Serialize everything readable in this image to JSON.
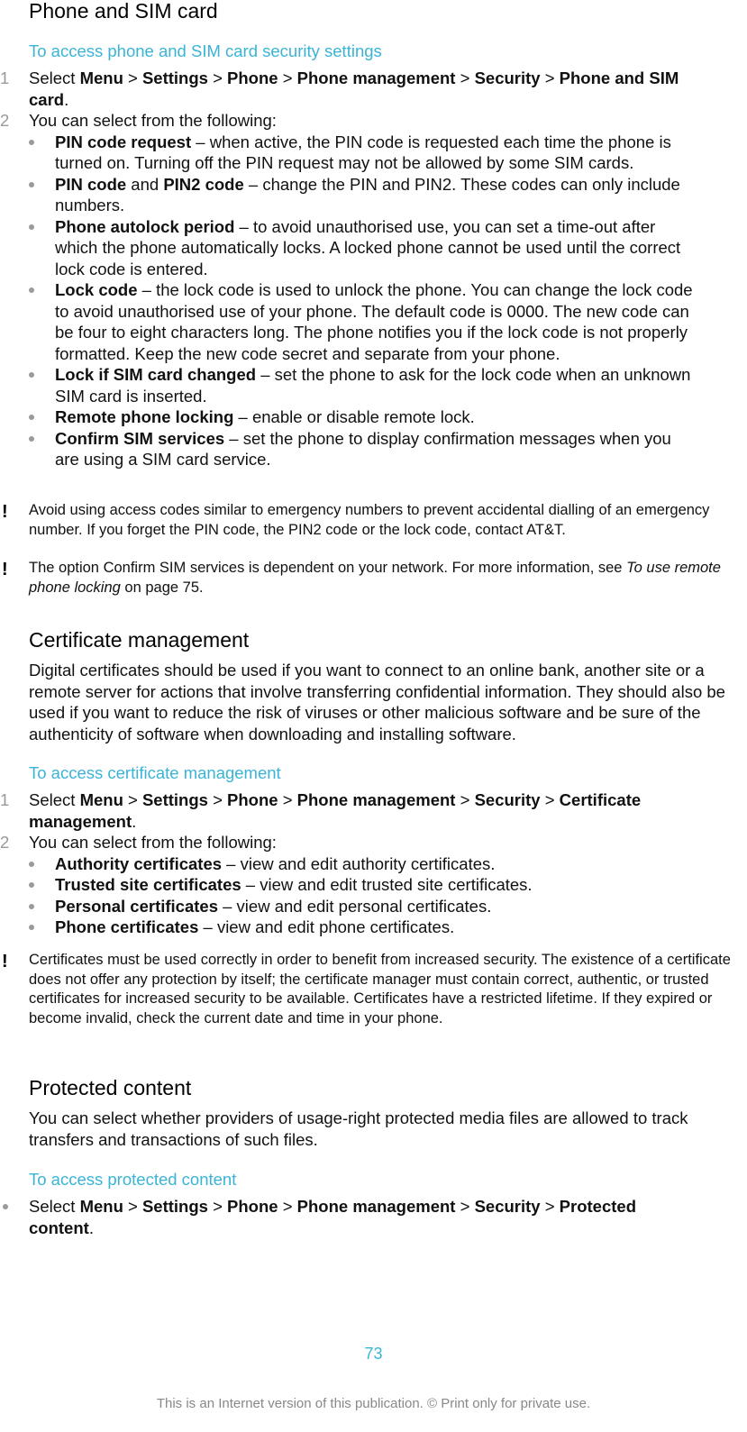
{
  "section1": {
    "title": "Phone and SIM card",
    "task_title": "To access phone and SIM card security settings",
    "step1": {
      "num": "1",
      "prefix": "Select ",
      "path": [
        "Menu",
        "Settings",
        "Phone",
        "Phone management",
        "Security",
        "Phone and SIM card"
      ],
      "sep": " > ",
      "suffix": "."
    },
    "step2": {
      "num": "2",
      "text": "You can select from the following:"
    },
    "options": [
      {
        "term": "PIN code request",
        "desc": " – when active, the PIN code is requested each time the phone is turned on. Turning off the PIN request may not be allowed by some SIM cards."
      },
      {
        "term": "PIN code",
        "mid": " and ",
        "term2": "PIN2 code",
        "desc": " – change the PIN and PIN2. These codes can only include numbers."
      },
      {
        "term": "Phone autolock period",
        "desc": " – to avoid unauthorised use, you can set a time-out after which the phone automatically locks. A locked phone cannot be used until the correct lock code is entered."
      },
      {
        "term": "Lock code",
        "desc": " – the lock code is used to unlock the phone. You can change the lock code to avoid unauthorised use of your phone. The default code is 0000. The new code can be four to eight characters long. The phone notifies you if the lock code is not properly formatted. Keep the new code secret and separate from your phone."
      },
      {
        "term": "Lock if SIM card changed",
        "desc": " – set the phone to ask for the lock code when an unknown SIM card is inserted."
      },
      {
        "term": "Remote phone locking",
        "desc": " – enable or disable remote lock."
      },
      {
        "term": "Confirm SIM services",
        "desc": " – set the phone to display confirmation messages when you are using a SIM card service."
      }
    ],
    "note1": "Avoid using access codes similar to emergency numbers to prevent accidental dialling of an emergency number. If you forget the PIN code, the PIN2 code or the lock code, contact AT&T.",
    "note2": {
      "prefix": "The option ",
      "term": "Confirm SIM services",
      "middle": " is dependent on your network. For more information, see ",
      "link": "To use remote phone locking",
      "suffix": " on page 75."
    }
  },
  "section2": {
    "title": "Certificate management",
    "intro": "Digital certificates should be used if you want to connect to an online bank, another site or a remote server for actions that involve transferring confidential information. They should also be used if you want to reduce the risk of viruses or other malicious software and be sure of the authenticity of software when downloading and installing software.",
    "task_title": "To access certificate management",
    "step1": {
      "num": "1",
      "prefix": "Select ",
      "path": [
        "Menu",
        "Settings",
        "Phone",
        "Phone management",
        "Security",
        "Certificate management"
      ],
      "sep": " > ",
      "suffix": "."
    },
    "step2": {
      "num": "2",
      "text": "You can select from the following:"
    },
    "options": [
      {
        "term": "Authority certificates",
        "desc": " – view and edit authority certificates."
      },
      {
        "term": "Trusted site certificates",
        "desc": " – view and edit trusted site certificates."
      },
      {
        "term": "Personal certificates",
        "desc": " – view and edit personal certificates."
      },
      {
        "term": "Phone certificates",
        "desc": " – view and edit phone certificates."
      }
    ],
    "note": "Certificates must be used correctly in order to benefit from increased security. The existence of a certificate does not offer any protection by itself; the certificate manager must contain correct, authentic, or trusted certificates for increased security to be available. Certificates have a restricted lifetime. If they expired or become invalid, check the current date and time in your phone."
  },
  "section3": {
    "title": "Protected content",
    "intro": "You can select whether providers of usage-right protected media files are allowed to track transfers and transactions of such files.",
    "task_title": "To access protected content",
    "step": {
      "prefix": "Select ",
      "path": [
        "Menu",
        "Settings",
        "Phone",
        "Phone management",
        "Security",
        "Protected content"
      ],
      "sep": " > ",
      "suffix": "."
    }
  },
  "footer": {
    "page_number": "73",
    "notice": "This is an Internet version of this publication. © Print only for private use."
  },
  "icons": {
    "note": "exclamation-icon"
  },
  "colors": {
    "accent": "#3ab4d6",
    "text": "#111111",
    "muted": "#888888"
  }
}
